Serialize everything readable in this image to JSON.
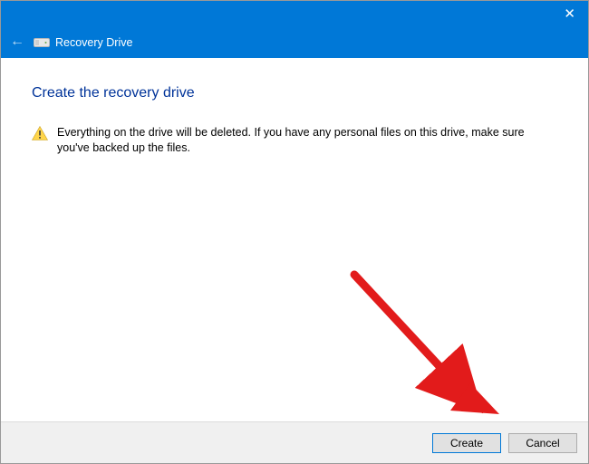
{
  "titlebar": {
    "close_label": "✕"
  },
  "header": {
    "back_arrow_glyph": "←",
    "window_title": "Recovery Drive"
  },
  "main": {
    "page_title": "Create the recovery drive",
    "warning_text": "Everything on the drive will be deleted. If you have any personal files on this drive, make sure you've backed up the files."
  },
  "footer": {
    "primary_label": "Create",
    "cancel_label": "Cancel"
  }
}
